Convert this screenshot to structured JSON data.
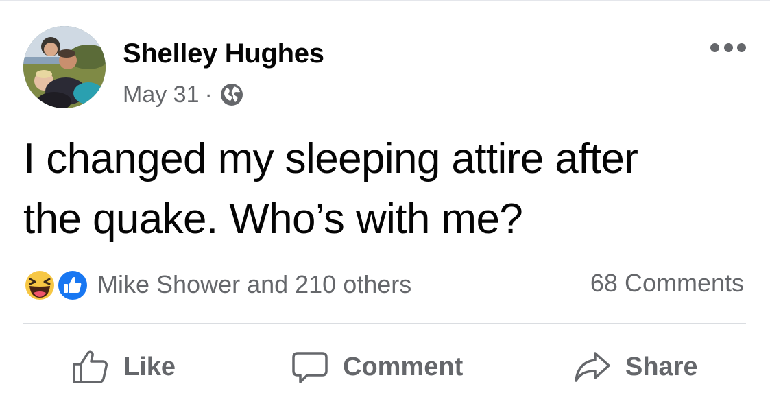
{
  "post": {
    "author": "Shelley Hughes",
    "date": "May 31",
    "separator": "·",
    "privacy_icon": "globe-icon",
    "text_line1": "I changed my sleeping attire after",
    "text_line2": "the quake. Who’s with me?"
  },
  "menu": {
    "icon": "more-options-icon"
  },
  "reactions": {
    "icons": [
      "haha-reaction-icon",
      "like-reaction-icon"
    ],
    "summary": "Mike Shower and 210 others",
    "comments": "68 Comments"
  },
  "actions": {
    "like_label": "Like",
    "comment_label": "Comment",
    "share_label": "Share"
  },
  "colors": {
    "like_blue": "#1877f2",
    "haha_yellow": "#f7c744",
    "secondary_text": "#65676b"
  }
}
